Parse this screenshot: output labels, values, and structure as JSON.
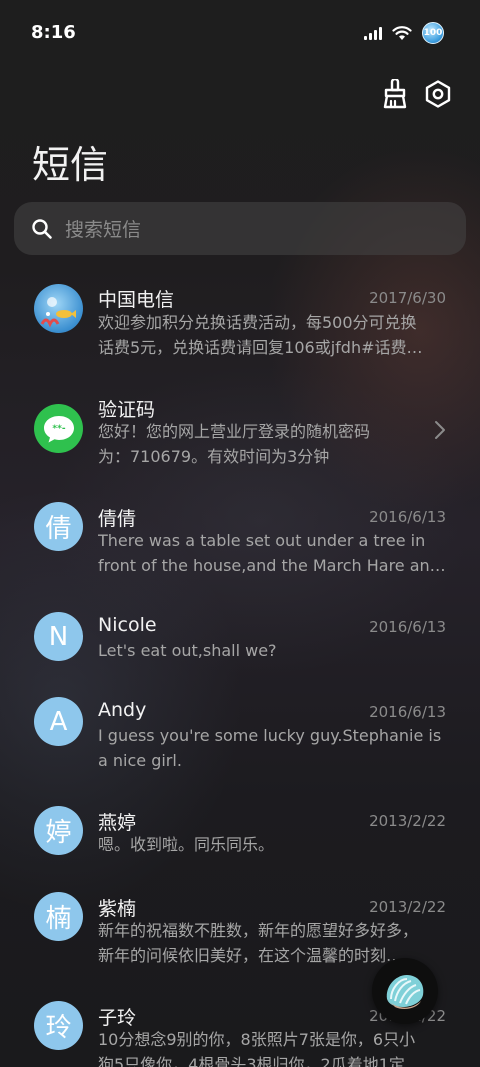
{
  "status_bar": {
    "time": "8:16",
    "battery_label": "100"
  },
  "header": {
    "title": "短信",
    "actions": [
      "broom-icon",
      "settings-icon"
    ]
  },
  "search": {
    "placeholder": "搜索短信"
  },
  "conversations": [
    {
      "name": "中国电信",
      "date": "2017/6/30",
      "preview": [
        "欢迎参加积分兑换话费活动，每500分可兑换",
        "话费5元，兑换话费请回复106或jfdh#话费…"
      ],
      "avatar_type": "image"
    },
    {
      "name": "验证码",
      "date": "",
      "preview": [
        "您好！您的网上营业厅登录的随机密码",
        "为：710679。有效时间为3分钟"
      ],
      "avatar_type": "message-icon",
      "avatar_color": "#2fc14e"
    },
    {
      "name": "倩倩",
      "date": "2016/6/13",
      "preview": [
        "There was a table set out under a tree in",
        "front of the house,and the March Hare an…"
      ],
      "avatar_letter": "倩"
    },
    {
      "name": "Nicole",
      "date": "2016/6/13",
      "preview": [
        "Let's eat out,shall we?"
      ],
      "avatar_letter": "N"
    },
    {
      "name": "Andy",
      "date": "2016/6/13",
      "preview": [
        "I guess you're some lucky guy.Stephanie is",
        "a nice girl."
      ],
      "avatar_letter": "A"
    },
    {
      "name": "燕婷",
      "date": "2013/2/22",
      "preview": [
        "嗯。收到啦。同乐同乐。"
      ],
      "avatar_letter": "婷"
    },
    {
      "name": "紫楠",
      "date": "2013/2/22",
      "preview": [
        "新年的祝福数不胜数，新年的愿望好多好多，",
        "新年的问候依旧美好，在这个温馨的时刻…"
      ],
      "avatar_letter": "楠"
    },
    {
      "name": "子玲",
      "date": "2013/2/22",
      "preview": [
        "10分想念9别的你，8张照片7张是你，6只小",
        "狗5只像你，4根骨头3根归你，2瓜着地1定"
      ],
      "avatar_letter": "玲"
    }
  ],
  "colors": {
    "avatar_blue": "#8ec7ec",
    "background": "#1e1e1e"
  }
}
